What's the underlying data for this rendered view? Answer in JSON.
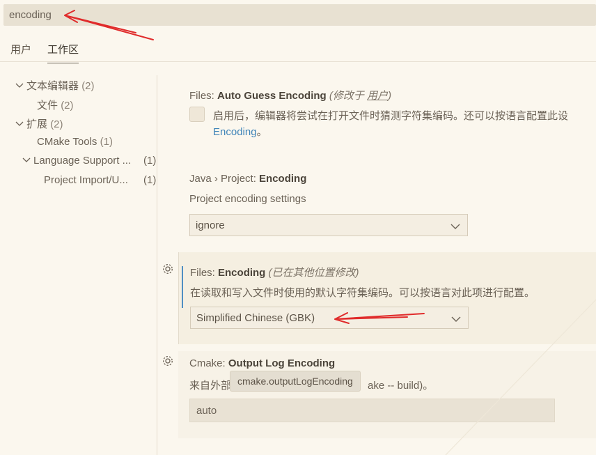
{
  "search": {
    "value": "encoding"
  },
  "tabs": [
    {
      "label": "用户"
    },
    {
      "label": "工作区"
    }
  ],
  "toc": [
    {
      "label": "文本编辑器",
      "count": "(2)",
      "expanded": true
    },
    {
      "label": "文件",
      "count": "(2)"
    },
    {
      "label": "扩展",
      "count": "(2)",
      "expanded": true
    },
    {
      "label": "CMake Tools",
      "count": "(1)"
    },
    {
      "label": "Language Support ...",
      "count": "(1)",
      "expanded": true
    },
    {
      "label": "Project Import/U...",
      "count": "(1)"
    }
  ],
  "settings": {
    "auto_guess": {
      "prefix": "Files: ",
      "name": "Auto Guess Encoding",
      "modified_open": "(修改于 ",
      "modified_link": "用户",
      "modified_close": ")",
      "desc": "启用后，编辑器将尝试在打开文件时猜测字符集编码。还可以按语言配置此设",
      "link": "Encoding",
      "link_tail": "。"
    },
    "java_encoding": {
      "prefix": "Java › Project: ",
      "name": "Encoding",
      "desc": "Project encoding settings",
      "value": "ignore"
    },
    "files_encoding": {
      "prefix": "Files: ",
      "name": "Encoding",
      "modified": "(已在其他位置修改)",
      "desc": "在读取和写入文件时使用的默认字符集编码。可以按语言对此项进行配置。",
      "value": "Simplified Chinese (GBK)"
    },
    "cmake_log": {
      "prefix": "Cmake: ",
      "name": "Output Log Encoding",
      "desc_start": "来自外部",
      "desc_end": "ake -- build)。",
      "value": "auto"
    }
  },
  "tooltip": "cmake.outputLogEncoding",
  "colors": {
    "background": "#fbf7ee",
    "accent": "#4f8ec3",
    "arrow": "#e02b2b",
    "link": "#3f84b8"
  }
}
